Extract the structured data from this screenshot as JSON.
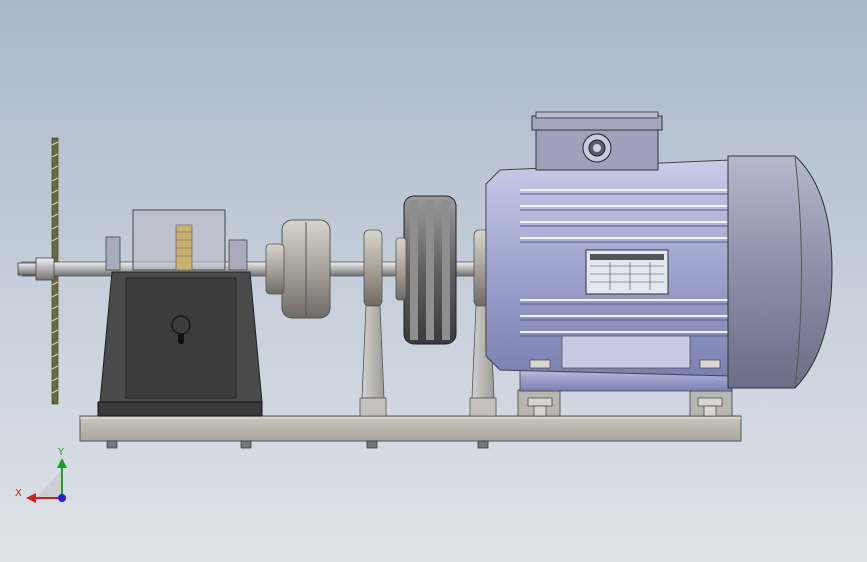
{
  "viewport": {
    "background_top": "#aab8cc",
    "background_bottom": "#dfe3e9"
  },
  "model": {
    "parts": [
      "base-plate",
      "saw-blade",
      "gearbox-housing",
      "shaft",
      "coupling",
      "shaft-support",
      "v-belt-pulley",
      "electric-motor",
      "terminal-box",
      "motor-nameplate",
      "anchor-bolts"
    ]
  },
  "triad": {
    "x_label": "X",
    "y_label": "Y",
    "x_color": "#d02020",
    "y_color": "#20a020",
    "z_color": "#2020d0"
  }
}
